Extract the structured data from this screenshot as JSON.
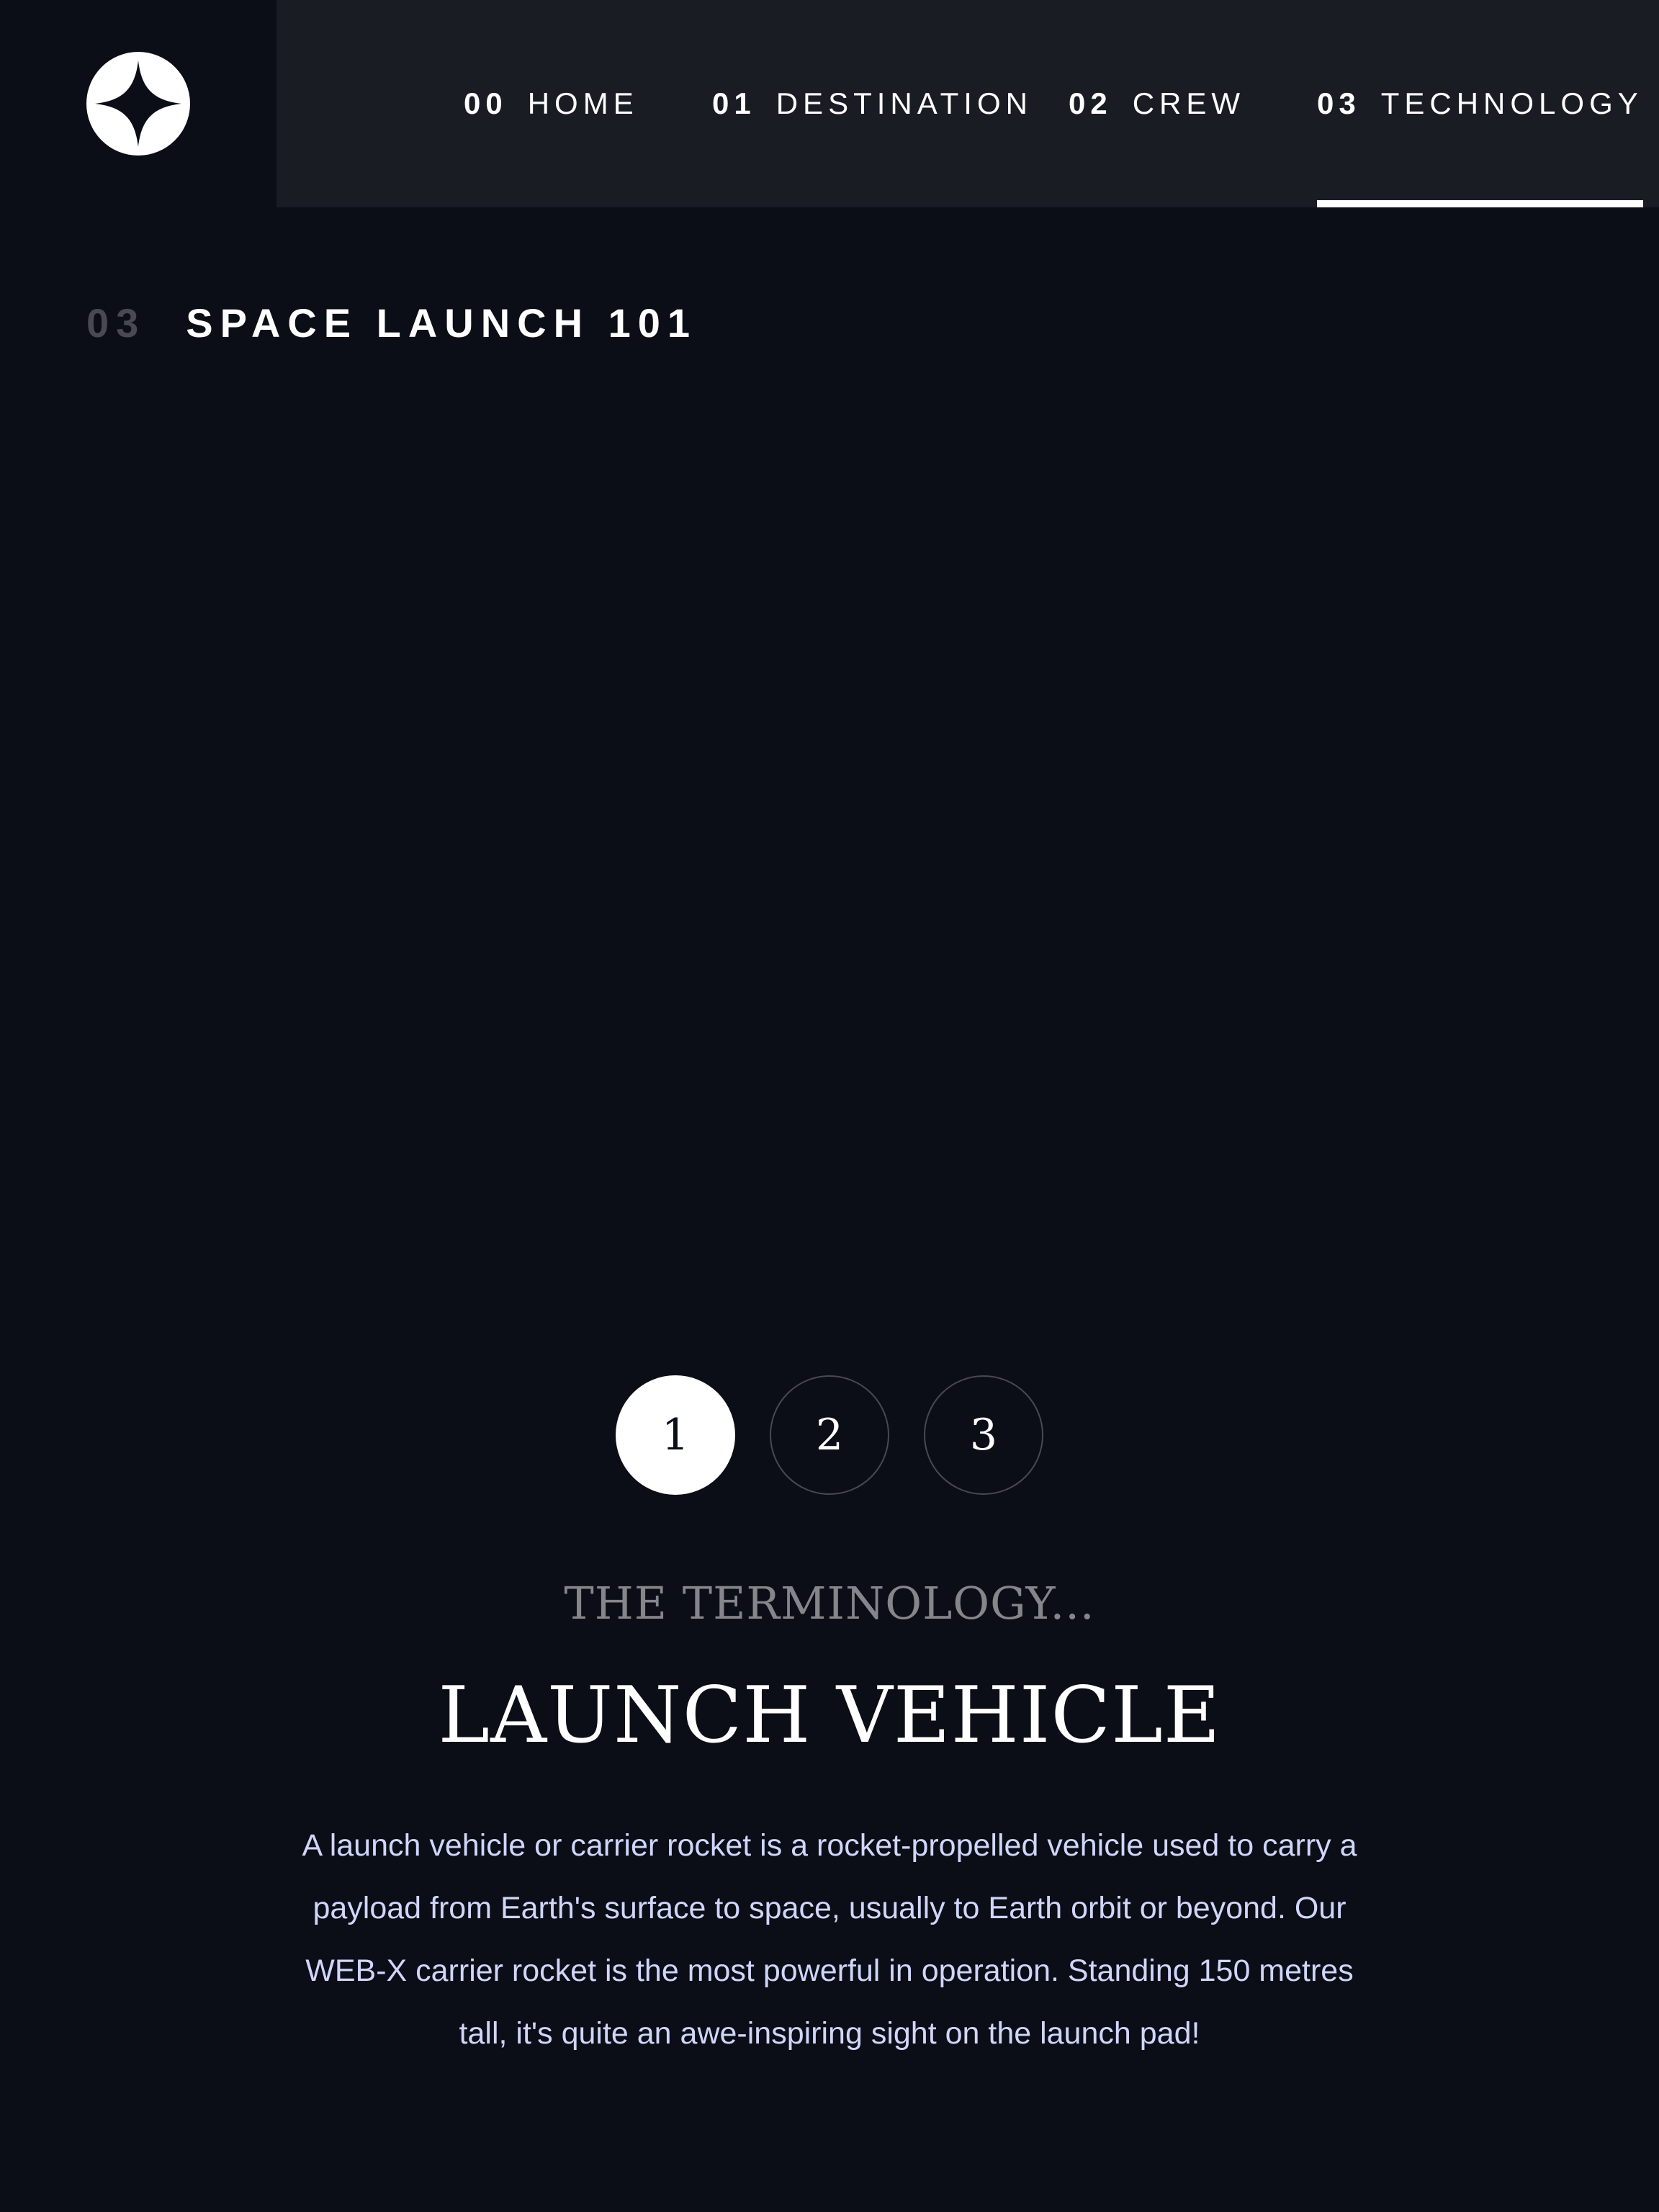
{
  "header": {
    "logo_icon": "star-logo-icon",
    "nav": [
      {
        "num": "00",
        "label": "HOME",
        "active": false
      },
      {
        "num": "01",
        "label": "DESTINATION",
        "active": false
      },
      {
        "num": "02",
        "label": "CREW",
        "active": false
      },
      {
        "num": "03",
        "label": "TECHNOLOGY",
        "active": true
      }
    ]
  },
  "page_heading": {
    "num": "03",
    "text": "SPACE LAUNCH 101"
  },
  "pager": {
    "buttons": [
      "1",
      "2",
      "3"
    ],
    "active_index": 0
  },
  "content": {
    "subheading": "THE TERMINOLOGY...",
    "title": "LAUNCH VEHICLE",
    "description": "A launch vehicle or carrier rocket is a rocket-propelled vehicle used to carry a payload from Earth's surface to space, usually to Earth orbit or beyond. Our WEB-X carrier rocket is the most powerful in operation. Standing 150 metres tall, it's quite an awe-inspiring sight on the launch pad!"
  },
  "colors": {
    "background": "#0b0d17",
    "navbar": "#1a1c24",
    "text": "#ffffff",
    "body_text": "#d0d6f9"
  }
}
